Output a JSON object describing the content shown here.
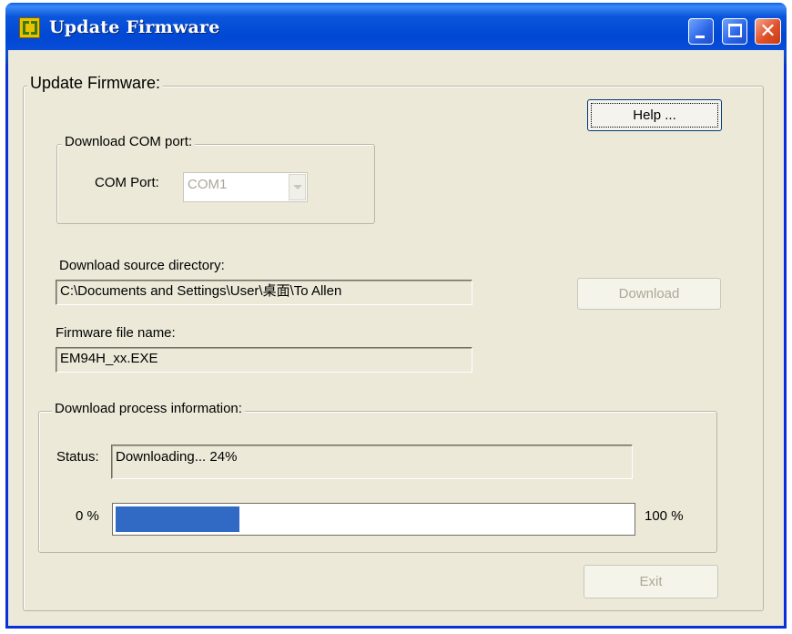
{
  "window": {
    "title": "Update Firmware",
    "app_icon": "ef-app-icon",
    "controls": {
      "minimize": "minimize-icon",
      "maximize": "maximize-icon",
      "close": "close-icon",
      "close_glyph": "✕"
    }
  },
  "main_group": {
    "legend": "Update Firmware:"
  },
  "help_button": {
    "label": "Help ..."
  },
  "com_group": {
    "legend": "Download COM port:",
    "com_port_label": "COM Port:",
    "com_port_value": "COM1"
  },
  "source_dir": {
    "label": "Download source directory:",
    "value": "C:\\Documents and Settings\\User\\桌面\\To Allen"
  },
  "download_button": {
    "label": "Download"
  },
  "firmware": {
    "label": "Firmware file name:",
    "value": "EM94H_xx.EXE"
  },
  "process_group": {
    "legend": "Download process information:",
    "status_label": "Status:",
    "status_value": "Downloading... 24%",
    "progress_min_label": "0 %",
    "progress_max_label": "100 %",
    "progress_fraction": 0.24
  },
  "exit_button": {
    "label": "Exit"
  },
  "colors": {
    "title_bar": "#0a4fd8",
    "client_bg": "#ece9d8",
    "progress_fill": "#316ac5",
    "close_button": "#e0512a"
  }
}
